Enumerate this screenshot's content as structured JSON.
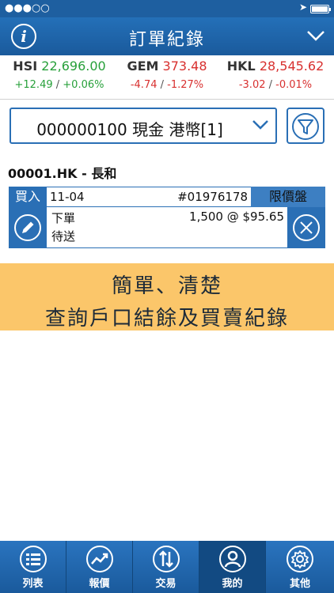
{
  "status_bar": {
    "signal": "●●●○○",
    "time": "",
    "location_icon": "location-arrow-icon"
  },
  "header": {
    "title": "訂單紀錄",
    "info_icon": "i",
    "menu_icon": "chevron-down-icon"
  },
  "indices": [
    {
      "name": "HSI",
      "value": "22,696.00",
      "change": "+12.49",
      "sep": "/",
      "pct": "+0.06%",
      "dir": "up"
    },
    {
      "name": "GEM",
      "value": "373.48",
      "change": "-4.74",
      "sep": "/",
      "pct": "-1.27%",
      "dir": "down"
    },
    {
      "name": "HKL",
      "value": "28,545.62",
      "change": "-3.02",
      "sep": "/",
      "pct": "-0.01%",
      "dir": "down"
    }
  ],
  "account": {
    "selected": "000000100 現金 港幣[1]"
  },
  "stock": {
    "title": "00001.HK - 長和"
  },
  "order": {
    "side": "買入",
    "date": "11-04",
    "number": "#01976178",
    "type": "限價盤",
    "status_line1": "下單",
    "status_line2": "待送",
    "quantity_price": "1,500 @ $95.65"
  },
  "promo": {
    "line1": "簡單、清楚",
    "line2": "查詢戶口結餘及買賣紀錄"
  },
  "tabs": [
    {
      "label": "列表",
      "icon": "list-icon"
    },
    {
      "label": "報價",
      "icon": "trend-chart-icon"
    },
    {
      "label": "交易",
      "icon": "trade-arrows-icon"
    },
    {
      "label": "我的",
      "icon": "user-icon",
      "active": true
    },
    {
      "label": "其他",
      "icon": "gear-icon"
    }
  ],
  "colors": {
    "brand_blue": "#1e5fa0",
    "up": "#27a03a",
    "down": "#d8302f",
    "promo_bg": "#fbc66a"
  }
}
